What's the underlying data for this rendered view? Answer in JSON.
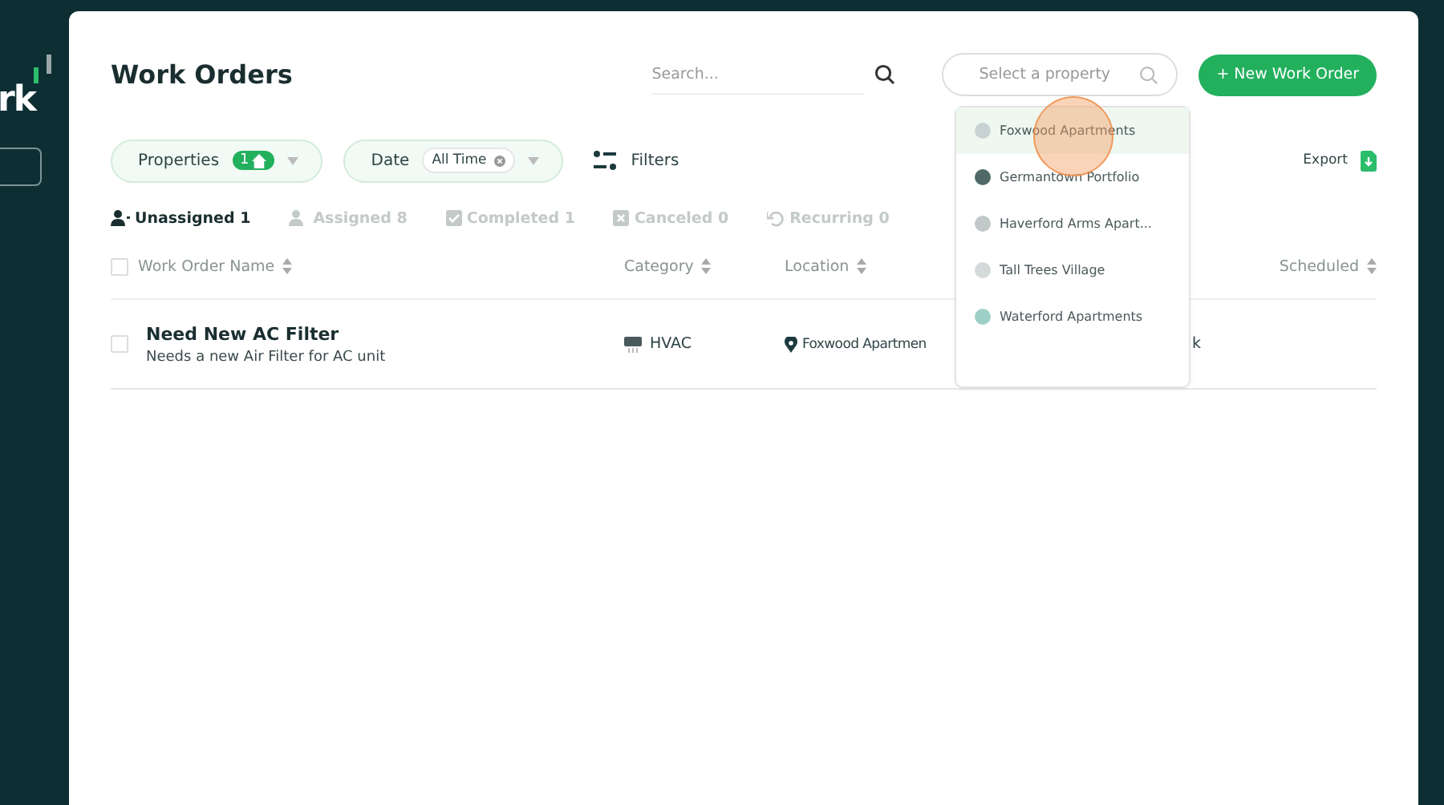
{
  "sidebar": {
    "logo_text": "rk"
  },
  "header": {
    "title": "Work Orders",
    "search": {
      "placeholder": "Search..."
    },
    "property_select": {
      "placeholder": "Select a property"
    },
    "new_button": "+ New Work Order"
  },
  "filters": [
    {
      "kind": "count",
      "label": "Properties",
      "value": "1"
    },
    {
      "kind": "chip",
      "label": "Date",
      "value": "All Time"
    },
    {
      "kind": "plain",
      "label": "Filters"
    }
  ],
  "export": "Export",
  "tabs": [
    {
      "label": "Unassigned 1",
      "selected": true
    },
    {
      "label": "Assigned 8",
      "selected": false
    },
    {
      "label": "Completed 1",
      "selected": false
    },
    {
      "label": "Canceled 0",
      "selected": false
    },
    {
      "label": "Recurring 0",
      "selected": false
    }
  ],
  "table": {
    "header_checked": false,
    "columns": [
      "Work Order Name",
      "Category",
      "Location",
      "Scheduled"
    ],
    "rows": [
      {
        "checked": false,
        "name": "Need New AC Filter",
        "description": "Needs a new Air Filter for AC unit",
        "category": "HVAC",
        "location": "Foxwood Apartmen",
        "column_4": "k"
      }
    ]
  },
  "dropdown": {
    "items": [
      {
        "label": "Foxwood Apartments",
        "selected": true
      },
      {
        "label": "Germantown Portfolio",
        "selected": false
      },
      {
        "label": "Haverford Arms Apart...",
        "selected": false
      },
      {
        "label": "Tall Trees Village",
        "selected": false
      },
      {
        "label": "Waterford Apartments",
        "selected": false
      }
    ]
  }
}
